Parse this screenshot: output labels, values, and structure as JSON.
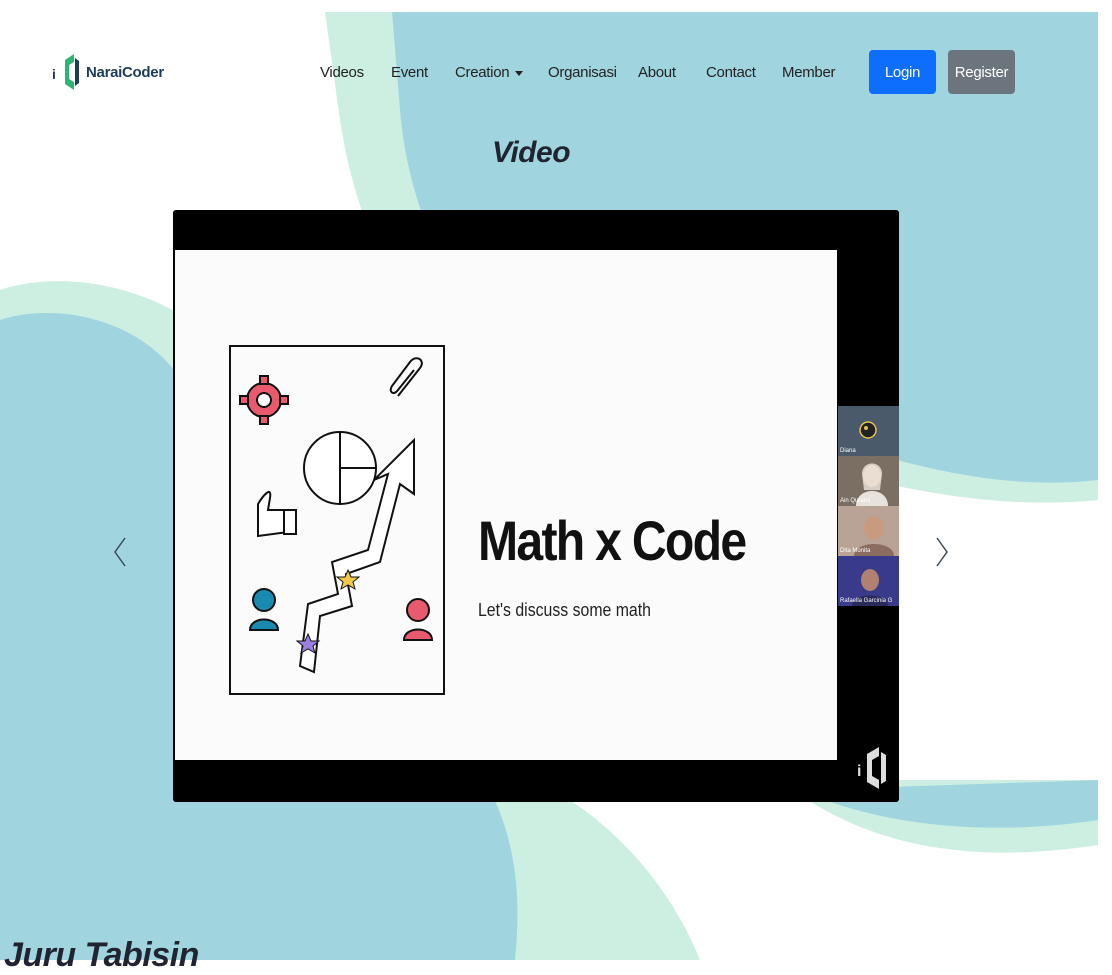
{
  "brand": {
    "logo_text": "NaraiCoder"
  },
  "nav": {
    "links": [
      "Videos",
      "Event",
      "Creation",
      "Organisasi",
      "About",
      "Contact",
      "Member"
    ],
    "login_label": "Login",
    "register_label": "Register"
  },
  "page": {
    "title": "Video",
    "next_section_title": "Juru Tabisin"
  },
  "video": {
    "slide_title": "Math x Code",
    "slide_subtitle": "Let's discuss some math",
    "participants": [
      "Diana",
      "Ain Quratul",
      "Dita Monita",
      "Rafaella Garcinia G"
    ]
  },
  "colors": {
    "blob_blue": "#a0d5e0",
    "blob_mint": "#ccefe2",
    "login_bg": "#0d6efd",
    "register_bg": "#6c757d",
    "logo_green": "#2bb673"
  },
  "icons": {
    "prev": "chevron-left-icon",
    "next": "chevron-right-icon",
    "dropdown": "caret-down-icon"
  }
}
